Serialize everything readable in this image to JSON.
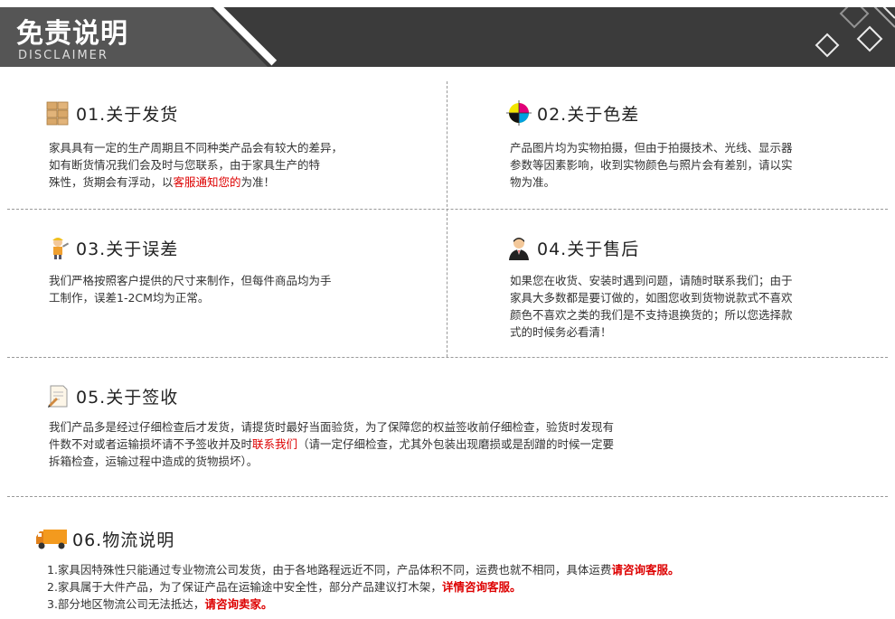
{
  "header": {
    "title": "免责说明",
    "subtitle": "DISCLAIMER"
  },
  "colors": {
    "accent_red": "#dd0000",
    "header_bg": "#3b3b3b",
    "divider": "#999999"
  },
  "sections": {
    "s1": {
      "icon": "boxes-icon",
      "title": "01.关于发货",
      "lines": [
        {
          "pre": "家具具有一定的生产周期且不同种类产品会有较大的差异，",
          "red": "",
          "post": ""
        },
        {
          "pre": "如有断货情况我们会及时与您联系，由于家具生产的特",
          "red": "",
          "post": ""
        },
        {
          "pre": "殊性，货期会有浮动，以",
          "red": "客服通知您的",
          "post": "为准！"
        }
      ]
    },
    "s2": {
      "icon": "color-wheel-icon",
      "title": "02.关于色差",
      "lines": [
        "产品图片均为实物拍摄，但由于拍摄技术、光线、显示器",
        "参数等因素影响，收到实物颜色与照片会有差别，请以实",
        "物为准。"
      ]
    },
    "s3": {
      "icon": "worker-icon",
      "title": "03.关于误差",
      "lines": [
        "我们严格按照客户提供的尺寸来制作，但每件商品均为手",
        "工制作，误差1-2CM均为正常。"
      ]
    },
    "s4": {
      "icon": "service-agent-icon",
      "title": "04.关于售后",
      "lines": [
        "如果您在收货、安装时遇到问题，请随时联系我们；由于",
        "家具大多数都是要订做的，如图您收到货物说款式不喜欢",
        "颜色不喜欢之类的我们是不支持退换货的；所以您选择款",
        "式的时候务必看清！"
      ]
    },
    "s5": {
      "icon": "sign-document-icon",
      "title": "05.关于签收",
      "line1": "我们产品多是经过仔细检查后才发货，请提货时最好当面验货，为了保障您的权益签收前仔细检查，验货时发现有",
      "line2_pre": "件数不对或者运输损坏请不予签收并及时",
      "line2_red": "联系我们",
      "line2_post": "（请一定仔细检查，尤其外包装出现磨损或是刮蹭的时候一定要",
      "line3": "拆箱检查，运输过程中造成的货物损坏）。"
    },
    "s6": {
      "icon": "delivery-truck-icon",
      "title": "06.物流说明",
      "lines": [
        {
          "pre": "1.家具因特殊性只能通过专业物流公司发货，由于各地路程远近不同，产品体积不同，运费也就不相同，具体运费",
          "red": "请咨询客服。"
        },
        {
          "pre": "2.家具属于大件产品，为了保证产品在运输途中安全性，部分产品建议打木架，",
          "red": "详情咨询客服。"
        },
        {
          "pre": "3.部分地区物流公司无法抵达，",
          "red": "请咨询卖家。"
        }
      ]
    }
  }
}
